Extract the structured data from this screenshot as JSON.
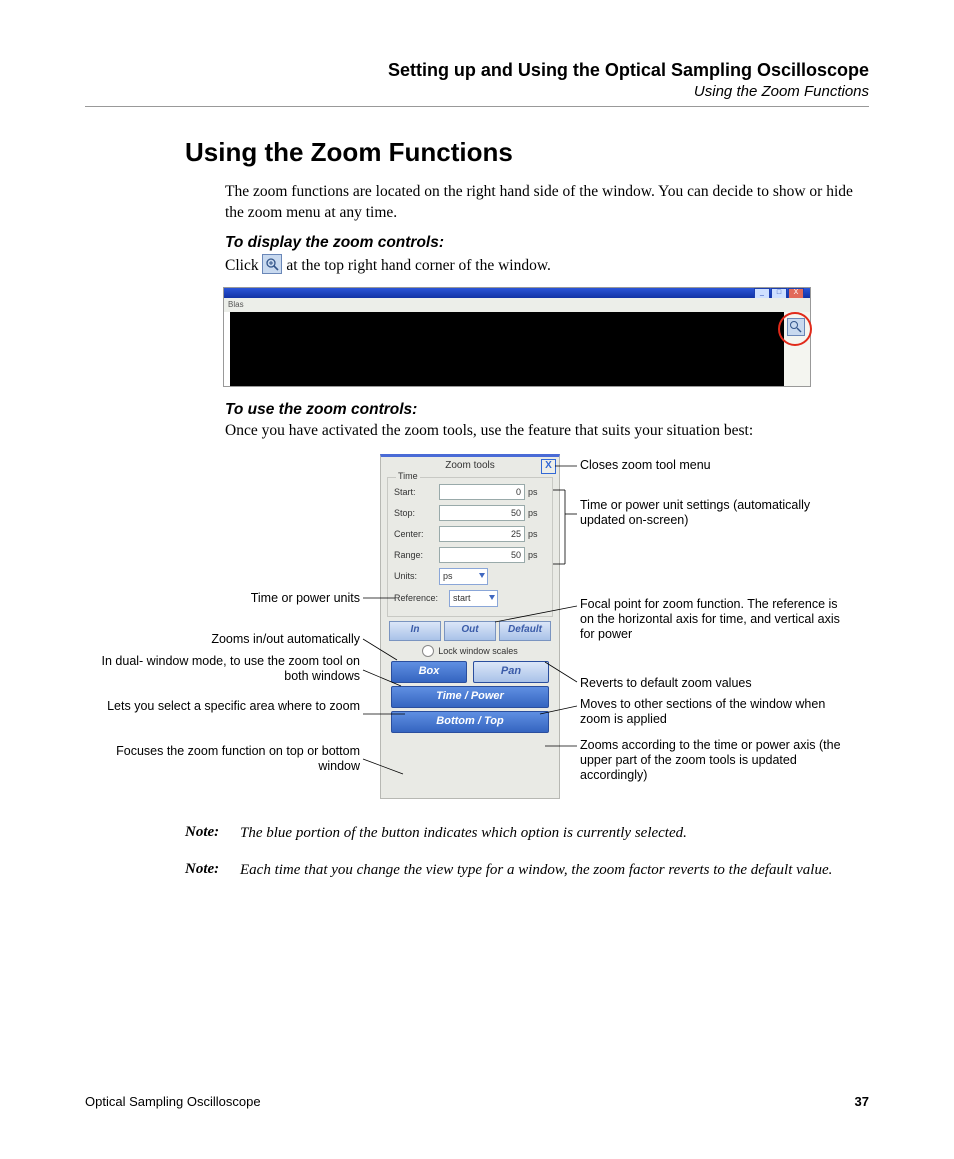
{
  "header": {
    "chapter": "Setting up and Using the Optical Sampling Oscilloscope",
    "section": "Using the Zoom Functions"
  },
  "title": "Using the Zoom Functions",
  "intro": "The zoom functions are located on the right hand side of the window. You can decide to show or hide the zoom menu at any time.",
  "display_heading": "To display the zoom controls:",
  "display_text_pre": "Click ",
  "display_text_post": " at the top right hand corner of the window.",
  "shot1": {
    "menu_hint": "Blas"
  },
  "use_heading": "To use the zoom controls:",
  "use_text": "Once you have activated the zoom tools, use the feature that suits your situation best:",
  "panel": {
    "title": "Zoom tools",
    "close": "X",
    "time_legend": "Time",
    "start_label": "Start:",
    "start_val": "0",
    "start_unit": "ps",
    "stop_label": "Stop:",
    "stop_val": "50",
    "stop_unit": "ps",
    "center_label": "Center:",
    "center_val": "25",
    "center_unit": "ps",
    "range_label": "Range:",
    "range_val": "50",
    "range_unit": "ps",
    "units_label": "Units:",
    "units_val": "ps",
    "ref_label": "Reference:",
    "ref_val": "start",
    "in": "In",
    "out": "Out",
    "default": "Default",
    "lock": "Lock window scales",
    "box": "Box",
    "pan": "Pan",
    "timepower": "Time / Power",
    "bottomtop": "Bottom / Top"
  },
  "callouts": {
    "close": "Closes zoom tool menu",
    "settings": "Time or power unit settings (automatically updated on-screen)",
    "units": "Time or power units",
    "ref": "Focal point for zoom function. The reference is on the horizontal axis for time, and vertical axis for power",
    "auto": "Zooms in/out automatically",
    "default": "Reverts to default zoom values",
    "dual": "In dual- window mode, to use the zoom tool on both windows",
    "pan": "Moves to other sections of the window when zoom is applied",
    "box": "Lets you select a specific area where to zoom",
    "tp": "Zooms according to the time or power axis (the upper part of the zoom tools is updated accordingly)",
    "bt": "Focuses the zoom function on top or bottom window"
  },
  "notes": {
    "label": "Note:",
    "n1": "The blue portion of the button indicates which option is currently selected.",
    "n2": "Each time that you change the view type for a window, the zoom factor reverts to the default value."
  },
  "footer": {
    "doc": "Optical Sampling Oscilloscope",
    "page": "37"
  }
}
